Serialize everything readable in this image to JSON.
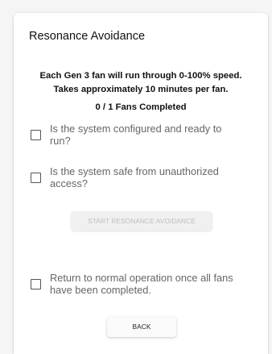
{
  "dialog": {
    "title": "Resonance Avoidance",
    "description_line1": "Each Gen 3 fan will run through 0-100% speed.",
    "description_line2": "Takes approximately 10 minutes per fan.",
    "progress_text": "0 / 1 Fans Completed"
  },
  "checklist": [
    {
      "label": "Is the system configured and ready to run?",
      "checked": false
    },
    {
      "label": "Is the system safe from unauthorized access?",
      "checked": false
    }
  ],
  "start_button": {
    "label": "START RESONANCE AVOIDANCE",
    "enabled": false
  },
  "return_option": {
    "label": "Return to normal operation once all fans have been completed.",
    "checked": false
  },
  "back_button": {
    "label": "BACK"
  },
  "colors": {
    "card_background": "#ffffff",
    "page_background": "#f5f5f5",
    "disabled_text": "#bdbdbd",
    "label_text": "#666666"
  }
}
